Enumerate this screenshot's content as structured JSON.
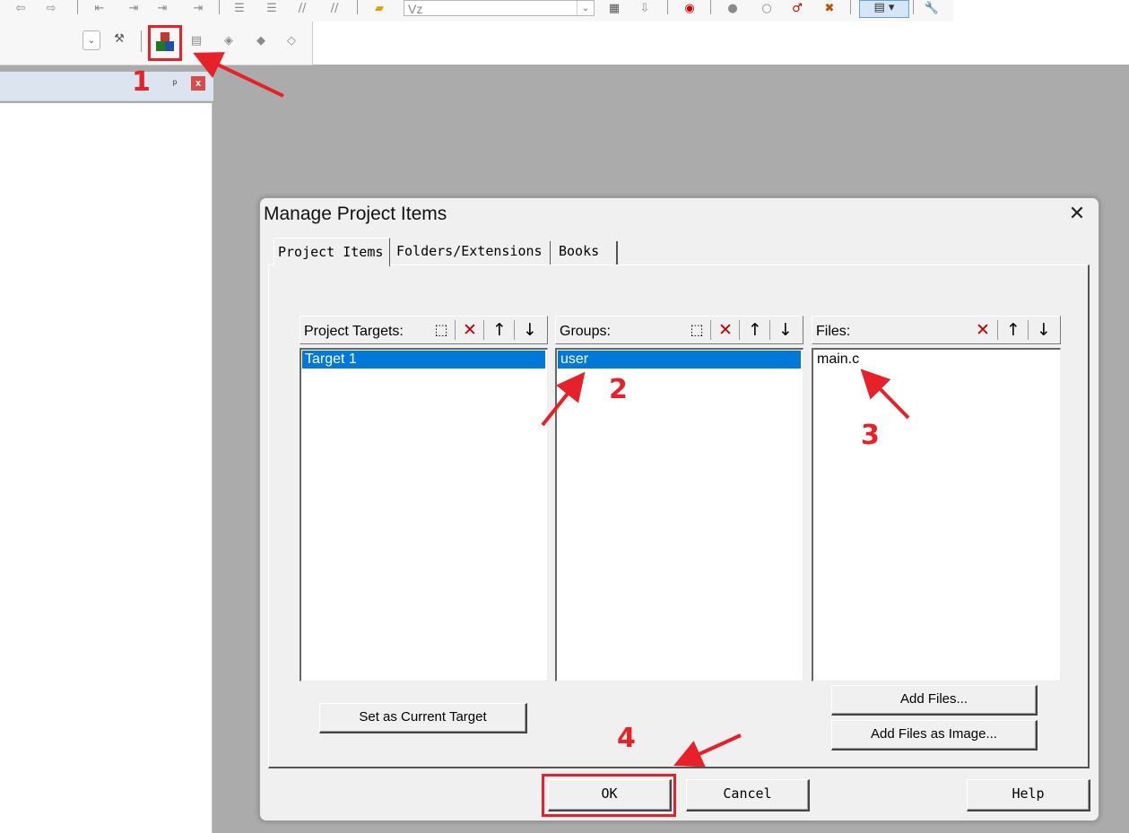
{
  "toolbar": {
    "build_combo_value": "Vz",
    "icons": [
      "arrow-left-icon",
      "arrow-right-icon",
      "indent-icon",
      "outdent-icon",
      "bookmark-icon",
      "comment-icon",
      "uncomment-icon",
      "open-folder-icon",
      "search-icon",
      "debug-icon",
      "breakpoint-icon",
      "settings-icon"
    ],
    "row2_icons": [
      "target-options-icon",
      "manage-project-items-icon",
      "select-packs-icon",
      "manage-runtime-icon",
      "packs-installer-icon"
    ]
  },
  "left_panel": {
    "pin_glyph": "📌",
    "close_glyph": "x"
  },
  "annotations": {
    "step1": "1",
    "step2": "2",
    "step3": "3",
    "step4": "4",
    "highlight_color": "#e62129"
  },
  "dialog": {
    "title": "Manage Project Items",
    "close_glyph": "✕",
    "tabs": [
      {
        "label": "Project Items",
        "active": true
      },
      {
        "label": "Folders/Extensions",
        "active": false
      },
      {
        "label": "Books",
        "active": false
      }
    ],
    "targets": {
      "header": "Project Targets:",
      "items": [
        "Target 1"
      ],
      "selected": "Target 1"
    },
    "groups": {
      "header": "Groups:",
      "items": [
        "user"
      ],
      "selected": "user"
    },
    "files": {
      "header": "Files:",
      "items": [
        "main.c"
      ]
    },
    "buttons": {
      "set_current_target": "Set as Current Target",
      "add_files": "Add Files...",
      "add_files_as_image": "Add Files as Image...",
      "ok": "OK",
      "cancel": "Cancel",
      "help": "Help"
    },
    "selection_color": "#0078d7"
  }
}
